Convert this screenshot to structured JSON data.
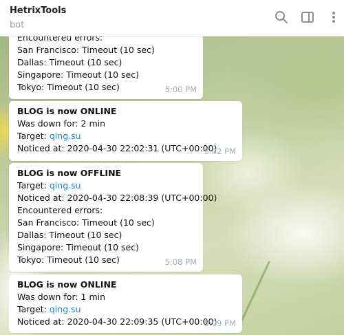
{
  "header": {
    "title": "HetrixTools",
    "subtitle": "bot"
  },
  "icons": {
    "search": "search-icon",
    "sidebar": "sidebar-toggle-icon",
    "menu": "more-vertical-icon"
  },
  "colors": {
    "link": "#168acd",
    "timestamp": "#a0acb6"
  },
  "messages": [
    {
      "lines": [
        "Encountered errors:",
        "San Francisco: Timeout (10 sec)",
        "Dallas: Timeout (10 sec)",
        "Singapore: Timeout (10 sec)",
        "Tokyo: Timeout (10 sec)"
      ],
      "time": "5:00 PM"
    },
    {
      "title": "BLOG is now ONLINE",
      "down_for": "Was down for: 2 min",
      "target_label": "Target: ",
      "target_link": "qing.su",
      "noticed": "Noticed at: 2020-04-30 22:02:31 (UTC+00:00)",
      "time": "5:02 PM"
    },
    {
      "title": "BLOG is now OFFLINE",
      "target_label": "Target: ",
      "target_link": "qing.su",
      "noticed": "Noticed at: 2020-04-30 22:08:39 (UTC+00:00)",
      "lines": [
        "Encountered errors:",
        "San Francisco: Timeout (10 sec)",
        "Dallas: Timeout (10 sec)",
        "Singapore: Timeout (10 sec)",
        "Tokyo: Timeout (10 sec)"
      ],
      "time": "5:08 PM"
    },
    {
      "title": "BLOG is now ONLINE",
      "down_for": "Was down for: 1 min",
      "target_label": "Target: ",
      "target_link": "qing.su",
      "noticed": "Noticed at: 2020-04-30 22:09:35 (UTC+00:00)",
      "time": "5:09 PM"
    }
  ]
}
